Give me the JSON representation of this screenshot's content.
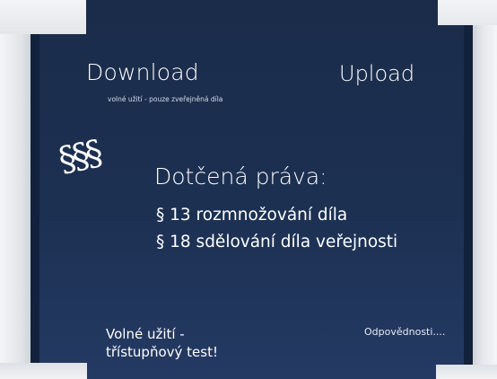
{
  "slide": {
    "download": {
      "title": "Download",
      "subtitle": "volné užití - pouze zveřejněná díla"
    },
    "upload": {
      "title": "Upload"
    },
    "symbols": "§§§",
    "rights": {
      "heading": "Dotčená práva:",
      "items": [
        "§ 13 rozmnožování díla",
        "§ 18 sdělování díla veřejnosti"
      ]
    },
    "fair_use": {
      "line1": "Volné užití -",
      "line2": "třístupňový test!"
    },
    "responsibility": "Odpovědnosti...."
  },
  "colors": {
    "background": "#1c3052",
    "frame": "#e3e6ea",
    "text": "#ffffff"
  }
}
